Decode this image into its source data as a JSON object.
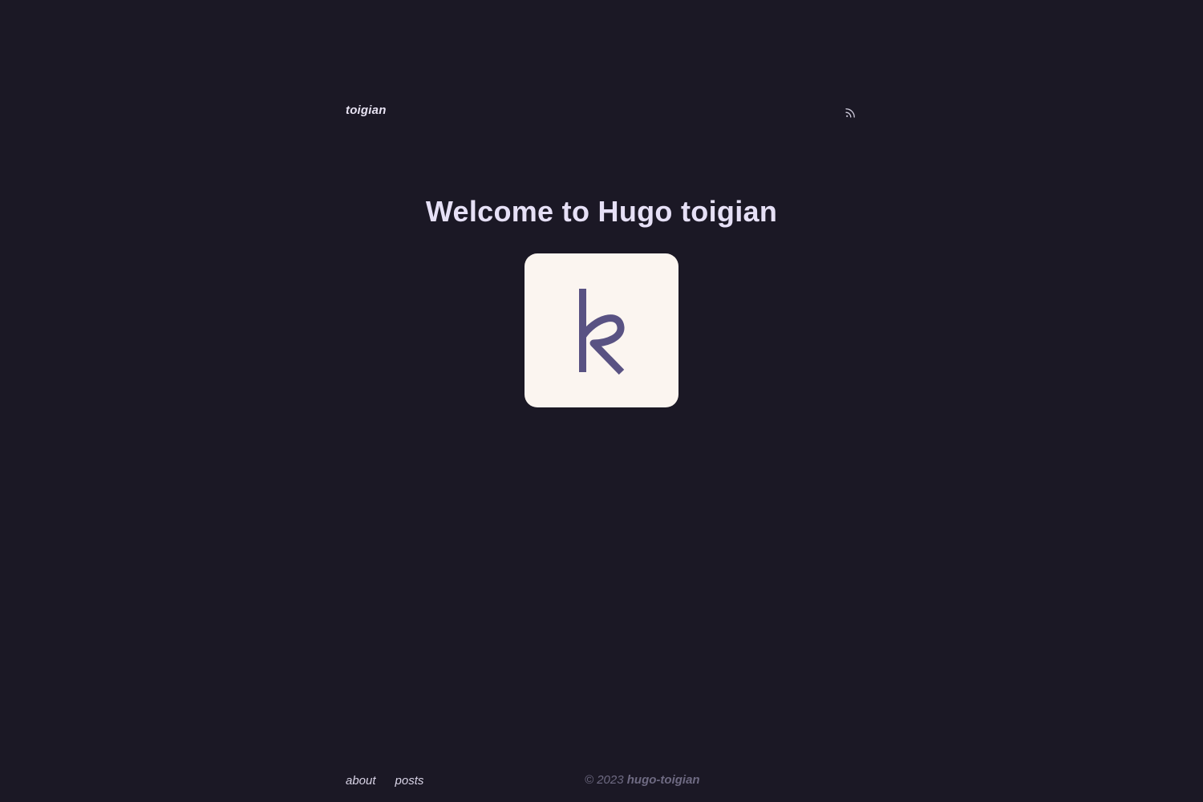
{
  "header": {
    "site_title": "toigian",
    "rss_icon": "rss-icon"
  },
  "main": {
    "headline": "Welcome to Hugo toigian",
    "logo_icon": "k-logo-icon"
  },
  "footer": {
    "nav": [
      {
        "label": "about"
      },
      {
        "label": "posts"
      }
    ],
    "copyright_prefix": "© 2023 ",
    "copyright_name": "hugo-toigian"
  },
  "colors": {
    "background": "#1b1825",
    "heading": "#e6e0f6",
    "logo_bg": "#fbf5f0",
    "logo_glyph": "#595283",
    "muted": "#6e6a82"
  }
}
